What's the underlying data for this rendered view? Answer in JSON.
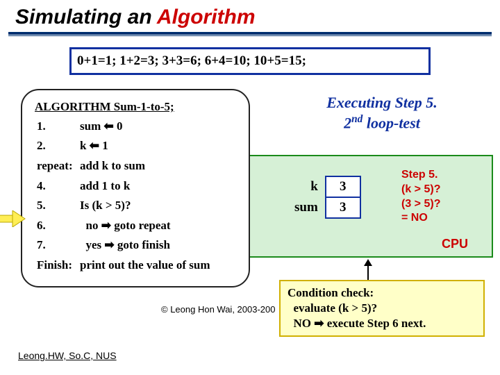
{
  "title_part1": "Simulating an ",
  "title_part2": "Algorithm",
  "equation": "0+1=1;  1+2=3;  3+3=6;  6+4=10;  10+5=15;",
  "algo": {
    "header": "ALGORITHM Sum-1-to-5;",
    "l1a": "1.",
    "l1b": "sum ⬅ 0",
    "l2a": "2.",
    "l2b": "k ⬅ 1",
    "l3a": "repeat:",
    "l3b": "add k to sum",
    "l4a": "4.",
    "l4b": "add 1 to k",
    "l5a": "5.",
    "l5b": "Is (k > 5)?",
    "l6a": "6.",
    "l6b": "  no ➡ goto repeat",
    "l7a": "7.",
    "l7b": "  yes ➡ goto finish",
    "l8a": "Finish:",
    "l8b": "print out the value of sum"
  },
  "exec": {
    "line1": "Executing Step 5.",
    "line2_a": "2",
    "line2_b": "nd",
    "line2_c": " loop-test"
  },
  "vars": {
    "k_label": "k",
    "k_val": "3",
    "sum_label": "sum",
    "sum_val": "3"
  },
  "step5": {
    "l1": "Step 5.",
    "l2": "(k > 5)?",
    "l3": "(3 > 5)?",
    "l4": "= NO"
  },
  "cpu": "CPU",
  "cond": {
    "l1": "Condition check:",
    "l2": "  evaluate (k > 5)?",
    "l3": "  NO ➡ execute Step 6 next."
  },
  "copyright": "© Leong Hon Wai, 2003-200",
  "footer": "Leong.HW, So.C, NUS"
}
